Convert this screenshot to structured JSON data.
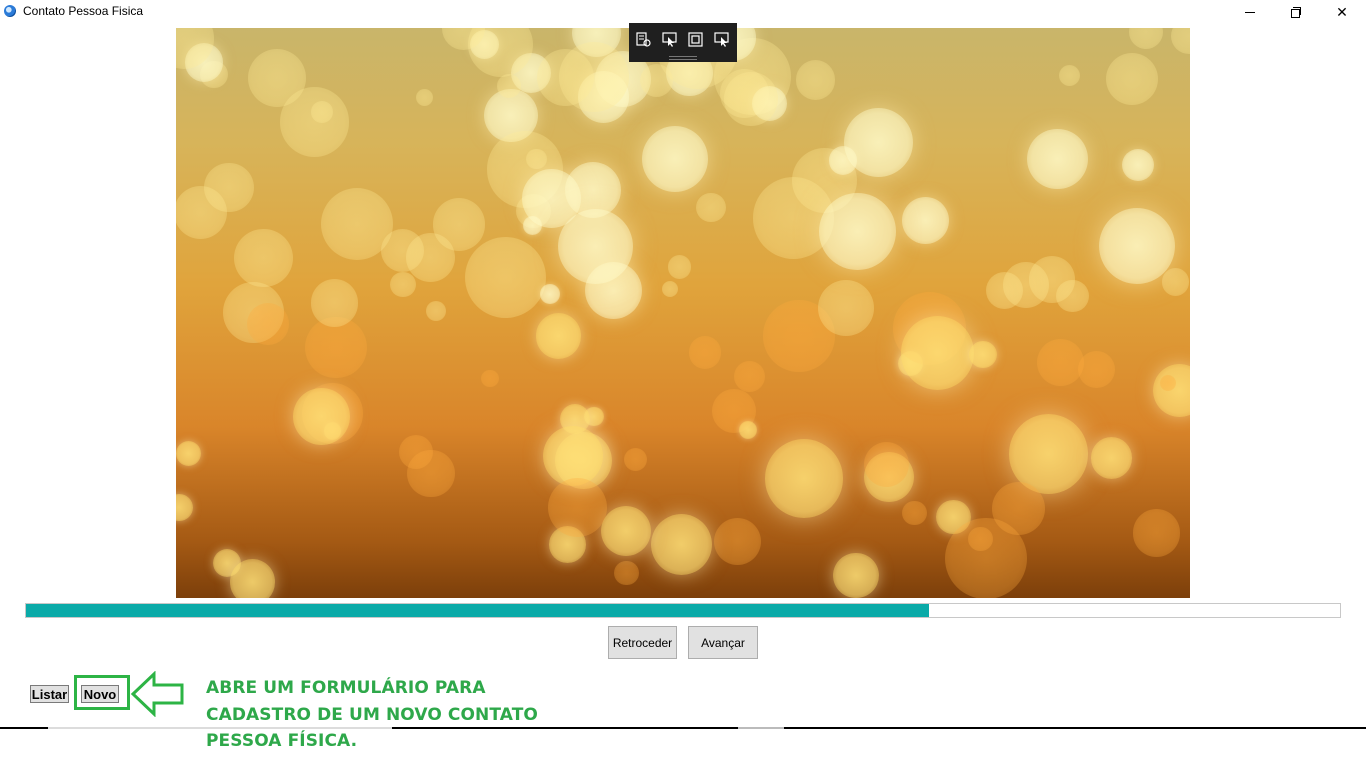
{
  "window": {
    "title": "Contato Pessoa Fisica",
    "icon": "app-globe-icon",
    "controls": [
      "minimize-icon",
      "restore-icon",
      "close-icon"
    ],
    "close_glyph": "✕"
  },
  "slideshow": {
    "image": "golden bokeh background",
    "toolbar_icons": [
      "select-mode-icon",
      "pointer-icon",
      "layout-bounds-icon",
      "track-focus-icon"
    ],
    "progress": 0.687,
    "progress_color": "#0aaaa8"
  },
  "navigation": {
    "prev_label": "Retroceder",
    "next_label": "Avançar"
  },
  "actions": {
    "list_label": "Listar",
    "new_label": "Novo"
  },
  "annotation": {
    "color": "#2ea84a",
    "line1": "ABRE UM FORMULÁRIO PARA",
    "line2": "CADASTRO DE UM NOVO CONTATO",
    "line3": "PESSOA FÍSICA."
  }
}
